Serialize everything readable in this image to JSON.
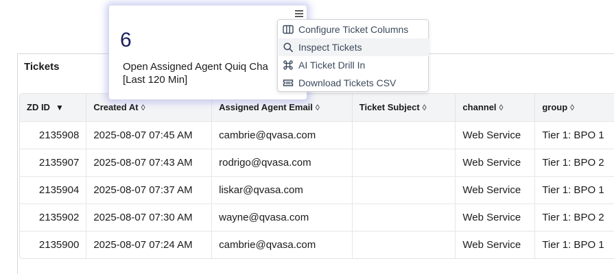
{
  "panel": {
    "title": "Tickets"
  },
  "kpi": {
    "value": "6",
    "label_line1": "Open Assigned Agent Quiq Cha",
    "label_line2": "[Last 120 Min]"
  },
  "menu": {
    "items": [
      {
        "label": "Configure Ticket Columns",
        "icon": "columns-icon"
      },
      {
        "label": "Inspect Tickets",
        "icon": "search-icon"
      },
      {
        "label": "AI Ticket Drill In",
        "icon": "command-icon"
      },
      {
        "label": "Download Tickets CSV",
        "icon": "ticket-icon"
      }
    ]
  },
  "table": {
    "columns": [
      {
        "label": "ZD ID",
        "sort": "▼"
      },
      {
        "label": "Created At",
        "sort": "◊"
      },
      {
        "label": "Assigned Agent Email",
        "sort": "◊"
      },
      {
        "label": "Ticket Subject",
        "sort": "◊"
      },
      {
        "label": "channel",
        "sort": "◊"
      },
      {
        "label": "group",
        "sort": "◊"
      }
    ],
    "rows": [
      {
        "id": "2135908",
        "created": "2025-08-07 07:45 AM",
        "email": "cambrie@qvasa.com",
        "subject": "",
        "channel": "Web Service",
        "group": "Tier 1: BPO 1"
      },
      {
        "id": "2135907",
        "created": "2025-08-07 07:43 AM",
        "email": "rodrigo@qvasa.com",
        "subject": "",
        "channel": "Web Service",
        "group": "Tier 1: BPO 2"
      },
      {
        "id": "2135904",
        "created": "2025-08-07 07:37 AM",
        "email": "liskar@qvasa.com",
        "subject": "",
        "channel": "Web Service",
        "group": "Tier 1: BPO 1"
      },
      {
        "id": "2135902",
        "created": "2025-08-07 07:30 AM",
        "email": "wayne@qvasa.com",
        "subject": "",
        "channel": "Web Service",
        "group": "Tier 1: BPO 2"
      },
      {
        "id": "2135900",
        "created": "2025-08-07 07:24 AM",
        "email": "cambrie@qvasa.com",
        "subject": "",
        "channel": "Web Service",
        "group": "Tier 1: BPO 1"
      }
    ]
  }
}
